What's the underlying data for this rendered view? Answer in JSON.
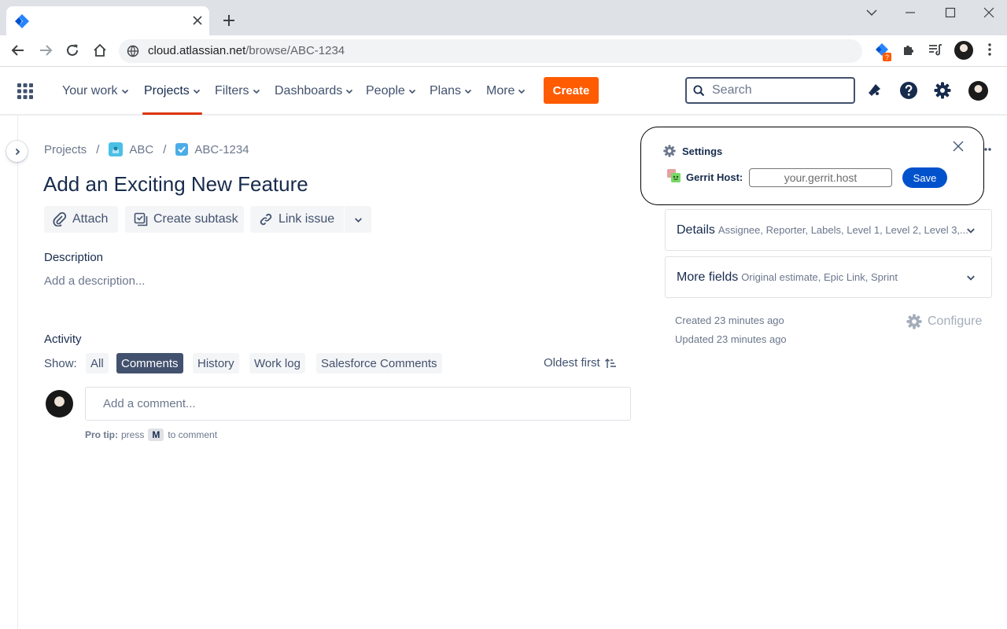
{
  "browser": {
    "tab": {
      "favicon": "jira-icon",
      "close_icon": "close-icon"
    },
    "new_tab_icon": "plus-icon",
    "window_controls": [
      "chevron-down-icon",
      "minimize-icon",
      "maximize-icon",
      "close-icon"
    ],
    "url": {
      "host": "cloud.atlassian.net",
      "path": "/browse/ABC-1234"
    },
    "extensions": [
      "jira-extension-icon",
      "puzzle-icon",
      "media-control-icon"
    ],
    "extension_badge": "?"
  },
  "nav": {
    "items": [
      {
        "label": "Your work",
        "active": false
      },
      {
        "label": "Projects",
        "active": true
      },
      {
        "label": "Filters",
        "active": false
      },
      {
        "label": "Dashboards",
        "active": false
      },
      {
        "label": "People",
        "active": false
      },
      {
        "label": "Plans",
        "active": false
      },
      {
        "label": "More",
        "active": false
      }
    ],
    "create_label": "Create",
    "search_placeholder": "Search",
    "accent_color": "#de350b",
    "create_color": "#ff5b00"
  },
  "breadcrumb": {
    "projects": "Projects",
    "project": "ABC",
    "issue_key": "ABC-1234"
  },
  "issue": {
    "title": "Add an Exciting New Feature",
    "actions": {
      "attach": "Attach",
      "create_subtask": "Create subtask",
      "link_issue": "Link issue"
    },
    "description_label": "Description",
    "description_placeholder": "Add a description..."
  },
  "activity": {
    "label": "Activity",
    "show_label": "Show:",
    "filters": [
      "All",
      "Comments",
      "History",
      "Work log",
      "Salesforce Comments"
    ],
    "selected_filter": "Comments",
    "sort_label": "Oldest first",
    "comment_placeholder": "Add a comment...",
    "pro_tip": {
      "prefix": "Pro tip:",
      "press": "press",
      "key": "M",
      "suffix": "to comment"
    }
  },
  "sidebar": {
    "details": {
      "title": "Details",
      "summary": "Assignee, Reporter, Labels, Level 1, Level 2, Level 3,..."
    },
    "more_fields": {
      "title": "More fields",
      "summary": "Original estimate, Epic Link, Sprint"
    },
    "created": "Created 23 minutes ago",
    "updated": "Updated 23 minutes ago",
    "configure": "Configure"
  },
  "popup": {
    "title": "Settings",
    "gerrit_label": "Gerrit Host:",
    "gerrit_placeholder": "your.gerrit.host",
    "save_label": "Save"
  }
}
